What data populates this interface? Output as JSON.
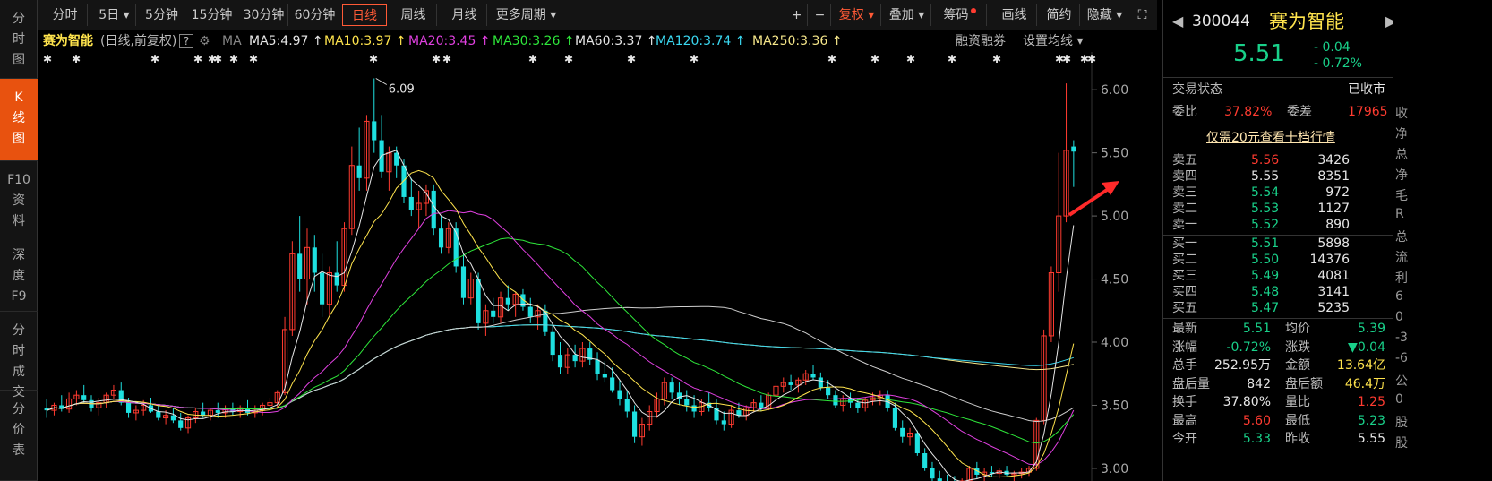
{
  "leftnav": [
    {
      "label": "分时图",
      "lines": [
        "分",
        "时",
        "图"
      ],
      "active": false
    },
    {
      "label": "K线图",
      "lines": [
        "K",
        "线",
        "图"
      ],
      "active": true
    },
    {
      "label": "F10资料",
      "lines": [
        "F10",
        "资",
        "料"
      ],
      "active": false
    },
    {
      "label": "深度F9",
      "lines": [
        "深",
        "度",
        "F9"
      ],
      "active": false
    },
    {
      "label": "分时成交",
      "lines": [
        "分",
        "时",
        "成",
        "交"
      ],
      "active": false
    },
    {
      "label": "分价表",
      "lines": [
        "分",
        "价",
        "表"
      ],
      "active": false
    }
  ],
  "toolbar": {
    "periods": [
      "分时",
      "5日",
      "5分钟",
      "15分钟",
      "30分钟",
      "60分钟",
      "日线",
      "周线",
      "月线",
      "更多周期"
    ],
    "active_period": "日线",
    "right": [
      "+",
      "−",
      "复权",
      "叠加",
      "筹码",
      "画线",
      "简约",
      "隐藏",
      "⛶"
    ]
  },
  "maline": {
    "name": "赛为智能",
    "mode": "(日线,前复权)",
    "help": "?",
    "ma": "MA",
    "items": [
      {
        "text": "MA5:4.97 ↑",
        "color": "#e6e6e6"
      },
      {
        "text": "MA10:3.97 ↑",
        "color": "#ffe44d"
      },
      {
        "text": "MA20:3.45 ↑",
        "color": "#e040e0"
      },
      {
        "text": "MA30:3.26 ↑",
        "color": "#2ee63a"
      },
      {
        "text": "MA60:3.37 ↑",
        "color": "#e6e6e6"
      },
      {
        "text": "MA120:3.74 ↑",
        "color": "#3ad7f0"
      },
      {
        "text": "MA250:3.36 ↑",
        "color": "#f5e68a"
      }
    ],
    "rzrq": "融资融券",
    "set_ma": "设置均线"
  },
  "chart_data": {
    "type": "candlestick",
    "ylim": [
      2.9,
      6.2
    ],
    "yticks": [
      "6.00",
      "5.50",
      "5.00",
      "4.50",
      "4.00",
      "3.50",
      "3.00"
    ],
    "annotation": "6.09",
    "candles": [
      [
        3.48,
        3.55,
        3.4,
        3.46
      ],
      [
        3.46,
        3.52,
        3.42,
        3.5
      ],
      [
        3.5,
        3.58,
        3.45,
        3.47
      ],
      [
        3.47,
        3.6,
        3.44,
        3.55
      ],
      [
        3.55,
        3.62,
        3.5,
        3.58
      ],
      [
        3.58,
        3.66,
        3.52,
        3.54
      ],
      [
        3.54,
        3.58,
        3.45,
        3.48
      ],
      [
        3.48,
        3.56,
        3.42,
        3.52
      ],
      [
        3.52,
        3.6,
        3.48,
        3.58
      ],
      [
        3.58,
        3.66,
        3.55,
        3.62
      ],
      [
        3.62,
        3.68,
        3.5,
        3.52
      ],
      [
        3.52,
        3.56,
        3.4,
        3.44
      ],
      [
        3.44,
        3.5,
        3.38,
        3.46
      ],
      [
        3.46,
        3.54,
        3.42,
        3.5
      ],
      [
        3.5,
        3.56,
        3.44,
        3.45
      ],
      [
        3.45,
        3.5,
        3.38,
        3.4
      ],
      [
        3.4,
        3.46,
        3.35,
        3.42
      ],
      [
        3.42,
        3.48,
        3.36,
        3.38
      ],
      [
        3.38,
        3.44,
        3.3,
        3.32
      ],
      [
        3.32,
        3.42,
        3.28,
        3.4
      ],
      [
        3.4,
        3.48,
        3.36,
        3.45
      ],
      [
        3.45,
        3.52,
        3.4,
        3.42
      ],
      [
        3.42,
        3.48,
        3.38,
        3.46
      ],
      [
        3.46,
        3.52,
        3.4,
        3.44
      ],
      [
        3.44,
        3.5,
        3.4,
        3.47
      ],
      [
        3.47,
        3.52,
        3.42,
        3.45
      ],
      [
        3.45,
        3.5,
        3.4,
        3.48
      ],
      [
        3.48,
        3.54,
        3.42,
        3.44
      ],
      [
        3.44,
        3.5,
        3.4,
        3.46
      ],
      [
        3.46,
        3.52,
        3.42,
        3.5
      ],
      [
        3.5,
        3.56,
        3.46,
        3.52
      ],
      [
        3.52,
        3.62,
        3.48,
        3.6
      ],
      [
        3.6,
        4.2,
        3.58,
        4.1
      ],
      [
        4.1,
        4.8,
        4.05,
        4.7
      ],
      [
        4.7,
        5.0,
        4.4,
        4.5
      ],
      [
        4.5,
        4.9,
        4.3,
        4.75
      ],
      [
        4.75,
        4.85,
        4.4,
        4.55
      ],
      [
        4.55,
        4.7,
        4.2,
        4.3
      ],
      [
        4.3,
        4.6,
        4.2,
        4.55
      ],
      [
        4.55,
        4.8,
        4.4,
        4.45
      ],
      [
        4.45,
        4.95,
        4.4,
        4.9
      ],
      [
        4.9,
        5.55,
        4.85,
        5.4
      ],
      [
        5.4,
        5.7,
        5.2,
        5.3
      ],
      [
        5.3,
        5.8,
        5.2,
        5.75
      ],
      [
        5.75,
        6.09,
        5.5,
        5.6
      ],
      [
        5.6,
        5.8,
        5.3,
        5.35
      ],
      [
        5.35,
        5.55,
        5.2,
        5.5
      ],
      [
        5.5,
        5.55,
        5.3,
        5.4
      ],
      [
        5.4,
        5.45,
        5.1,
        5.15
      ],
      [
        5.15,
        5.3,
        5.0,
        5.05
      ],
      [
        5.05,
        5.2,
        4.9,
        5.1
      ],
      [
        5.1,
        5.25,
        5.0,
        5.2
      ],
      [
        5.2,
        5.25,
        4.85,
        4.9
      ],
      [
        4.9,
        5.0,
        4.7,
        4.75
      ],
      [
        4.75,
        4.95,
        4.7,
        4.9
      ],
      [
        4.9,
        4.95,
        4.55,
        4.6
      ],
      [
        4.6,
        4.7,
        4.3,
        4.35
      ],
      [
        4.35,
        4.55,
        4.3,
        4.5
      ],
      [
        4.5,
        4.55,
        4.1,
        4.15
      ],
      [
        4.15,
        4.3,
        4.05,
        4.25
      ],
      [
        4.25,
        4.35,
        4.15,
        4.2
      ],
      [
        4.2,
        4.4,
        4.15,
        4.35
      ],
      [
        4.35,
        4.45,
        4.25,
        4.3
      ],
      [
        4.3,
        4.4,
        4.2,
        4.38
      ],
      [
        4.38,
        4.42,
        4.25,
        4.28
      ],
      [
        4.28,
        4.35,
        4.15,
        4.2
      ],
      [
        4.2,
        4.3,
        4.1,
        4.25
      ],
      [
        4.25,
        4.3,
        4.05,
        4.08
      ],
      [
        4.08,
        4.15,
        3.85,
        3.9
      ],
      [
        3.9,
        4.0,
        3.75,
        3.8
      ],
      [
        3.8,
        3.95,
        3.75,
        3.9
      ],
      [
        3.9,
        3.98,
        3.8,
        3.85
      ],
      [
        3.85,
        4.0,
        3.8,
        3.95
      ],
      [
        3.95,
        4.0,
        3.82,
        3.86
      ],
      [
        3.86,
        3.92,
        3.7,
        3.75
      ],
      [
        3.75,
        3.85,
        3.68,
        3.72
      ],
      [
        3.72,
        3.8,
        3.6,
        3.62
      ],
      [
        3.62,
        3.7,
        3.5,
        3.55
      ],
      [
        3.55,
        3.62,
        3.4,
        3.45
      ],
      [
        3.45,
        3.5,
        3.2,
        3.25
      ],
      [
        3.25,
        3.4,
        3.18,
        3.35
      ],
      [
        3.35,
        3.5,
        3.3,
        3.45
      ],
      [
        3.45,
        3.6,
        3.4,
        3.55
      ],
      [
        3.55,
        3.72,
        3.5,
        3.68
      ],
      [
        3.68,
        3.72,
        3.55,
        3.6
      ],
      [
        3.6,
        3.68,
        3.5,
        3.55
      ],
      [
        3.55,
        3.62,
        3.45,
        3.5
      ],
      [
        3.5,
        3.58,
        3.4,
        3.45
      ],
      [
        3.45,
        3.55,
        3.42,
        3.52
      ],
      [
        3.52,
        3.6,
        3.45,
        3.48
      ],
      [
        3.48,
        3.55,
        3.35,
        3.38
      ],
      [
        3.38,
        3.45,
        3.3,
        3.35
      ],
      [
        3.35,
        3.5,
        3.32,
        3.46
      ],
      [
        3.46,
        3.52,
        3.4,
        3.42
      ],
      [
        3.42,
        3.5,
        3.38,
        3.48
      ],
      [
        3.48,
        3.55,
        3.45,
        3.52
      ],
      [
        3.52,
        3.58,
        3.45,
        3.48
      ],
      [
        3.48,
        3.6,
        3.46,
        3.58
      ],
      [
        3.58,
        3.68,
        3.55,
        3.65
      ],
      [
        3.65,
        3.72,
        3.6,
        3.68
      ],
      [
        3.68,
        3.74,
        3.62,
        3.66
      ],
      [
        3.66,
        3.72,
        3.6,
        3.7
      ],
      [
        3.7,
        3.78,
        3.66,
        3.75
      ],
      [
        3.75,
        3.82,
        3.7,
        3.72
      ],
      [
        3.72,
        3.76,
        3.62,
        3.64
      ],
      [
        3.64,
        3.7,
        3.55,
        3.58
      ],
      [
        3.58,
        3.62,
        3.48,
        3.5
      ],
      [
        3.5,
        3.58,
        3.45,
        3.55
      ],
      [
        3.55,
        3.6,
        3.48,
        3.52
      ],
      [
        3.52,
        3.56,
        3.44,
        3.48
      ],
      [
        3.48,
        3.56,
        3.45,
        3.54
      ],
      [
        3.54,
        3.6,
        3.5,
        3.56
      ],
      [
        3.56,
        3.62,
        3.5,
        3.58
      ],
      [
        3.58,
        3.62,
        3.45,
        3.48
      ],
      [
        3.48,
        3.52,
        3.3,
        3.32
      ],
      [
        3.32,
        3.38,
        3.2,
        3.25
      ],
      [
        3.25,
        3.32,
        3.18,
        3.28
      ],
      [
        3.28,
        3.3,
        3.1,
        3.12
      ],
      [
        3.12,
        3.16,
        2.98,
        3.0
      ],
      [
        3.0,
        3.05,
        2.9,
        2.92
      ],
      [
        2.92,
        2.98,
        2.85,
        2.9
      ],
      [
        2.9,
        2.95,
        2.84,
        2.88
      ],
      [
        2.88,
        2.94,
        2.82,
        2.86
      ],
      [
        2.86,
        2.92,
        2.8,
        2.9
      ],
      [
        2.9,
        3.02,
        2.88,
        3.0
      ],
      [
        3.0,
        3.05,
        2.92,
        2.95
      ],
      [
        2.95,
        3.0,
        2.9,
        2.97
      ],
      [
        2.97,
        3.02,
        2.93,
        2.96
      ],
      [
        2.96,
        3.0,
        2.92,
        2.98
      ],
      [
        2.98,
        3.02,
        2.94,
        2.95
      ],
      [
        2.95,
        2.98,
        2.9,
        2.96
      ],
      [
        2.96,
        3.0,
        2.92,
        2.97
      ],
      [
        2.97,
        3.02,
        2.94,
        3.0
      ],
      [
        3.0,
        3.4,
        2.98,
        3.38
      ],
      [
        3.38,
        4.1,
        3.35,
        4.05
      ],
      [
        4.05,
        4.6,
        4.0,
        4.55
      ],
      [
        4.55,
        5.5,
        4.4,
        5.0
      ],
      [
        5.0,
        6.05,
        4.95,
        5.52
      ],
      [
        5.55,
        5.6,
        5.23,
        5.51
      ]
    ]
  },
  "stock": {
    "code": "300044",
    "name": "赛为智能",
    "price": "5.51",
    "change": "- 0.04",
    "pct": "- 0.72%"
  },
  "status": {
    "label": "交易状态",
    "value": "已收市"
  },
  "wei": {
    "wb_label": "委比",
    "wb_value": "37.82%",
    "wc_label": "委差",
    "wc_value": "17965"
  },
  "promo": "仅需20元查看十档行情",
  "asks": [
    {
      "label": "卖五",
      "price": "5.56",
      "vol": "3426",
      "color": "red"
    },
    {
      "label": "卖四",
      "price": "5.55",
      "vol": "8351",
      "color": "white"
    },
    {
      "label": "卖三",
      "price": "5.54",
      "vol": "972",
      "color": "green"
    },
    {
      "label": "卖二",
      "price": "5.53",
      "vol": "1127",
      "color": "green"
    },
    {
      "label": "卖一",
      "price": "5.52",
      "vol": "890",
      "color": "green"
    }
  ],
  "bids": [
    {
      "label": "买一",
      "price": "5.51",
      "vol": "5898",
      "color": "green"
    },
    {
      "label": "买二",
      "price": "5.50",
      "vol": "14376",
      "color": "green"
    },
    {
      "label": "买三",
      "price": "5.49",
      "vol": "4081",
      "color": "green"
    },
    {
      "label": "买四",
      "price": "5.48",
      "vol": "3141",
      "color": "green"
    },
    {
      "label": "买五",
      "price": "5.47",
      "vol": "5235",
      "color": "green"
    }
  ],
  "stats": [
    {
      "l1": "最新",
      "v1": "5.51",
      "c1": "green",
      "l2": "均价",
      "v2": "5.39",
      "c2": "green"
    },
    {
      "l1": "涨幅",
      "v1": "-0.72%",
      "c1": "green",
      "l2": "涨跌",
      "v2": "▼0.04",
      "c2": "green"
    },
    {
      "l1": "总手",
      "v1": "252.95万",
      "c1": "white",
      "l2": "金额",
      "v2": "13.64亿",
      "c2": "yellow"
    },
    {
      "l1": "盘后量",
      "v1": "842",
      "c1": "white",
      "l2": "盘后额",
      "v2": "46.4万",
      "c2": "yellow"
    },
    {
      "l1": "换手",
      "v1": "37.80%",
      "c1": "white",
      "l2": "量比",
      "v2": "1.25",
      "c2": "red"
    },
    {
      "l1": "最高",
      "v1": "5.60",
      "c1": "red",
      "l2": "最低",
      "v2": "5.23",
      "c2": "green"
    },
    {
      "l1": "今开",
      "v1": "5.33",
      "c1": "green",
      "l2": "昨收",
      "v2": "5.55",
      "c2": "white"
    }
  ],
  "farright": [
    "收",
    "净",
    "总",
    "净",
    "毛",
    "R",
    "总",
    "流",
    "利",
    "6",
    "0",
    "-3",
    "-6",
    "公",
    "0",
    "股",
    "股"
  ]
}
